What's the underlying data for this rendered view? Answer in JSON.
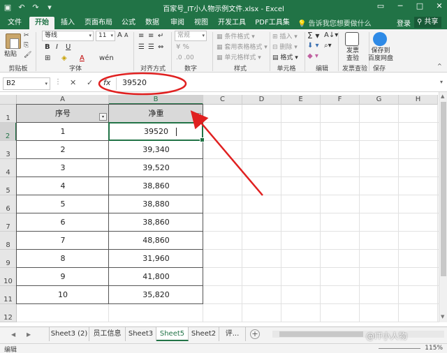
{
  "window": {
    "title": "百家号_IT小人物示例文件.xlsx - Excel",
    "min": "─",
    "max": "□",
    "close": "✕"
  },
  "tabs": [
    "文件",
    "开始",
    "插入",
    "页面布局",
    "公式",
    "数据",
    "审阅",
    "视图",
    "开发工具",
    "PDF工具集"
  ],
  "active_tab": "开始",
  "tell_me": "告诉我您想要做什么",
  "login": "登录",
  "share": "共享",
  "ribbon": {
    "paste": "粘贴",
    "font_name": "等线",
    "font_size": "11",
    "number_format": "常规",
    "conditional_format": "条件格式",
    "table_format": "套用表格格式",
    "cell_styles": "单元格样式",
    "insert": "插入",
    "delete": "删除",
    "format": "格式",
    "invoice_check": "发票查验",
    "invoice_check_l1": "发票",
    "invoice_check_l2": "查验",
    "baidu_save": "保存到百度网盘",
    "baidu_save_l1": "保存到",
    "baidu_save_l2": "百度网盘",
    "groups": [
      "剪贴板",
      "字体",
      "对齐方式",
      "数字",
      "样式",
      "单元格",
      "编辑",
      "发票查验",
      "保存"
    ]
  },
  "formula_bar": {
    "name_box": "B2",
    "value": "39520",
    "fx": "fx"
  },
  "columns": [
    "A",
    "B",
    "C",
    "D",
    "E",
    "F",
    "G",
    "H"
  ],
  "rows": [
    "1",
    "2",
    "3",
    "4",
    "5",
    "6",
    "7",
    "8",
    "9",
    "10",
    "11",
    "12"
  ],
  "table": {
    "headers": [
      "序号",
      "净重"
    ],
    "rows": [
      [
        "1",
        "39520"
      ],
      [
        "2",
        "39,340"
      ],
      [
        "3",
        "39,520"
      ],
      [
        "4",
        "38,860"
      ],
      [
        "5",
        "38,880"
      ],
      [
        "6",
        "38,860"
      ],
      [
        "7",
        "48,860"
      ],
      [
        "8",
        "31,960"
      ],
      [
        "9",
        "41,800"
      ],
      [
        "10",
        "35,820"
      ]
    ]
  },
  "sheets": [
    "Sheet3 (2)",
    "员工信息",
    "Sheet3",
    "Sheet5",
    "Sheet2",
    "评..."
  ],
  "active_sheet": "Sheet5",
  "status": {
    "mode": "编辑",
    "zoom": "115%"
  },
  "watermark": "@IT小人物",
  "colors": {
    "excel_green": "#217346",
    "annotation_red": "#e02020"
  }
}
